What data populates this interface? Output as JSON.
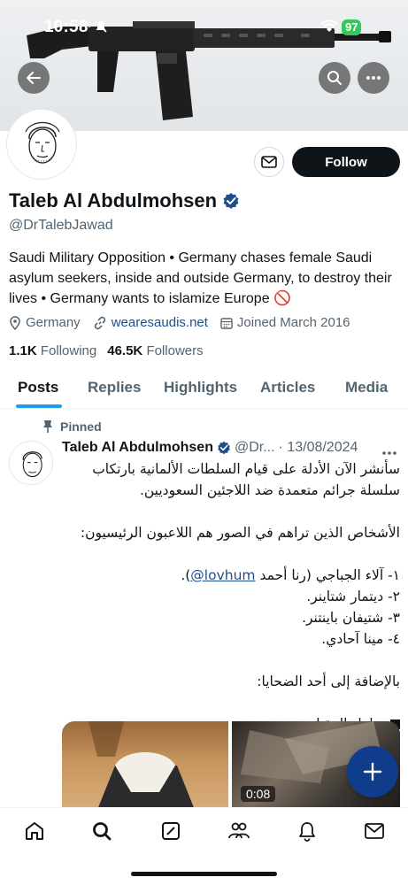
{
  "status_bar": {
    "time": "10:58",
    "battery": "97"
  },
  "profile": {
    "name": "Taleb Al Abdulmohsen",
    "handle": "@DrTalebJawad",
    "bio": "Saudi Military Opposition • Germany chases female Saudi asylum seekers, inside and outside Germany, to destroy their lives • Germany wants to islamize Europe 🚫",
    "location": "Germany",
    "website": "wearesaudis.net",
    "joined": "Joined March 2016",
    "following_count": "1.1K",
    "following_label": "Following",
    "followers_count": "46.5K",
    "followers_label": "Followers",
    "follow_button": "Follow"
  },
  "tabs": [
    "Posts",
    "Replies",
    "Highlights",
    "Articles",
    "Media"
  ],
  "active_tab": "Posts",
  "pinned_post": {
    "pinned_label": "Pinned",
    "author": "Taleb Al Abdulmohsen",
    "handle": "@Dr...",
    "date": "· 13/08/2024",
    "line1": "سأنشر الآن الأدلة على قيام السلطات الألمانية بارتكاب",
    "line2": "سلسلة جرائم متعمدة ضد اللاجئين السعوديين.",
    "line3": "الأشخاص الذين تراهم في الصور هم اللاعبون الرئيسيون:",
    "line4_prefix": "١- آلاء الجباجي (رنا أحمد ",
    "line4_mention": "@lovhum",
    "line4_suffix": ").",
    "line5": "٢- ديتمار شتاينر.",
    "line6": "٣- شتيفان باينتنر.",
    "line7": "٤- مينا آحادي.",
    "line8": "بالإضافة إلى أحد الضحايا:",
    "line9": "مناهل المقبل",
    "video_duration": "0:08"
  },
  "icons": {
    "back": "arrow-left-icon",
    "search": "search-icon",
    "more": "more-icon",
    "message": "mail-icon",
    "verified": "verified-badge-icon",
    "location": "location-pin-icon",
    "link": "link-icon",
    "calendar": "calendar-icon",
    "pin": "pin-icon",
    "compose": "plus-icon"
  },
  "colors": {
    "verified": "#1d4e89",
    "accent": "#1d9bf0",
    "fab": "#0f3d8c",
    "follow_bg": "#0f1419"
  }
}
